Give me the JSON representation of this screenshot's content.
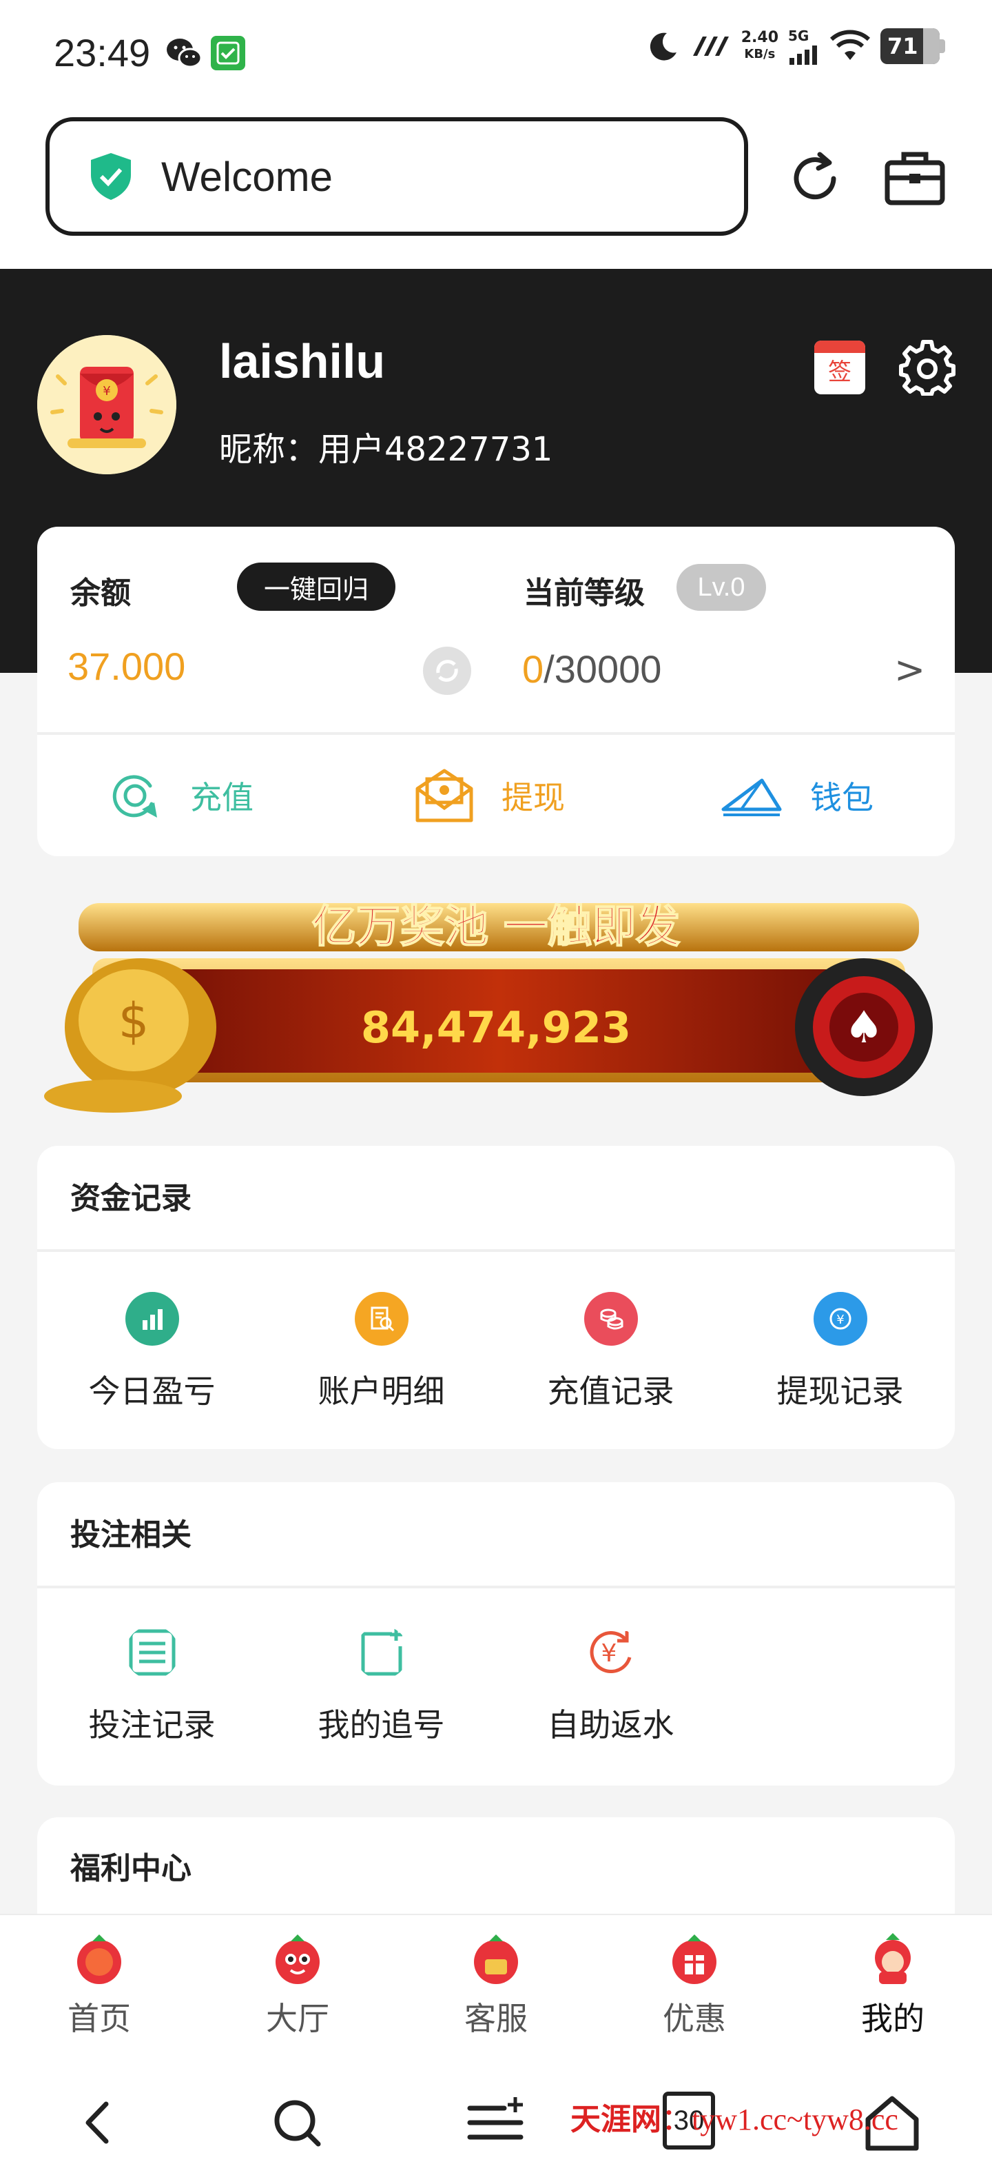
{
  "status_bar": {
    "time": "23:49",
    "net_speed_value": "2.40",
    "net_speed_unit": "KB/s",
    "network": "5G",
    "battery": "71"
  },
  "browser": {
    "url_text": "Welcome"
  },
  "profile": {
    "username": "laishilu",
    "nickname": "昵称：用户48227731",
    "sign_label": "签"
  },
  "balance_card": {
    "balance_label": "余额",
    "return_button": "一键回归",
    "balance_value": "37.000",
    "level_label": "当前等级",
    "level_badge": "Lv.0",
    "level_current": "0",
    "level_total": "/30000",
    "arrow": ">",
    "actions": {
      "recharge": "充值",
      "withdraw": "提现",
      "wallet": "钱包"
    }
  },
  "banner": {
    "title": "亿万奖池 一触即发",
    "amount": "84,474,923"
  },
  "funds": {
    "title": "资金记录",
    "items": [
      {
        "label": "今日盈亏",
        "color": "#2fae8a"
      },
      {
        "label": "账户明细",
        "color": "#f5a623"
      },
      {
        "label": "充值记录",
        "color": "#ea4d5b"
      },
      {
        "label": "提现记录",
        "color": "#2c9ae8"
      }
    ]
  },
  "betting": {
    "title": "投注相关",
    "items": [
      {
        "label": "投注记录",
        "color": "#3ebea0"
      },
      {
        "label": "我的追号",
        "color": "#3ebea0"
      },
      {
        "label": "自助返水",
        "color": "#e8563a"
      }
    ]
  },
  "welfare": {
    "title": "福利中心"
  },
  "tabbar": {
    "tabs": [
      {
        "label": "首页"
      },
      {
        "label": "大厅"
      },
      {
        "label": "客服"
      },
      {
        "label": "优惠"
      },
      {
        "label": "我的"
      }
    ]
  },
  "sysnav": {
    "tabs_count": "30",
    "watermark_brand": "天涯网",
    "watermark_url": "：tyw1.cc~tyw8.cc"
  },
  "colors": {
    "header_bg": "#1c1c1c",
    "accent_orange": "#f0a020",
    "accent_green": "#3ebea0",
    "accent_blue": "#1e90e0"
  }
}
